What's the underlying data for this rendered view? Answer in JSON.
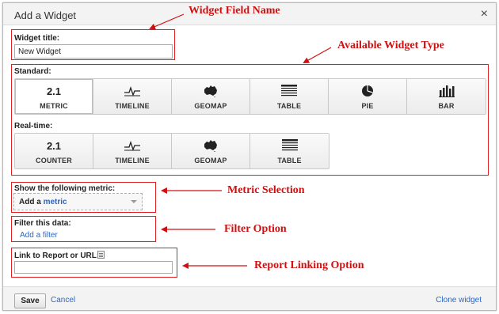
{
  "dialog": {
    "title": "Add a Widget",
    "close_icon": "×"
  },
  "widget_title": {
    "label": "Widget title:",
    "value": "New Widget"
  },
  "standard": {
    "label": "Standard:",
    "tiles": [
      {
        "icon_text": "2.1",
        "icon": "number-icon",
        "label": "METRIC",
        "selected": true
      },
      {
        "icon": "timeline-icon",
        "label": "TIMELINE"
      },
      {
        "icon": "australia-map-icon",
        "label": "GEOMAP"
      },
      {
        "icon": "table-icon",
        "label": "TABLE"
      },
      {
        "icon": "pie-chart-icon",
        "label": "PIE"
      },
      {
        "icon": "bar-chart-icon",
        "label": "BAR"
      }
    ]
  },
  "realtime": {
    "label": "Real-time:",
    "tiles": [
      {
        "icon_text": "2.1",
        "icon": "number-icon",
        "label": "COUNTER"
      },
      {
        "icon": "timeline-icon",
        "label": "TIMELINE"
      },
      {
        "icon": "australia-map-icon",
        "label": "GEOMAP"
      },
      {
        "icon": "table-icon",
        "label": "TABLE"
      }
    ]
  },
  "metric": {
    "label": "Show the following metric:",
    "dropdown_prefix": "Add a",
    "dropdown_link": "metric"
  },
  "filter": {
    "label": "Filter this data:",
    "add_link": "Add a filter"
  },
  "report_link": {
    "label": "Link to Report or URL:",
    "value": ""
  },
  "footer": {
    "save_label": "Save",
    "cancel_label": "Cancel",
    "clone_label": "Clone widget"
  },
  "annotations": {
    "field_name": "Widget Field Name",
    "widget_type": "Available Widget Type",
    "metric_selection": "Metric Selection",
    "filter_option": "Filter Option",
    "report_linking": "Report Linking Option"
  },
  "colors": {
    "annotation_red": "#d01010",
    "link_blue": "#2a66c9",
    "chrome_gray": "#f3f3f3"
  }
}
